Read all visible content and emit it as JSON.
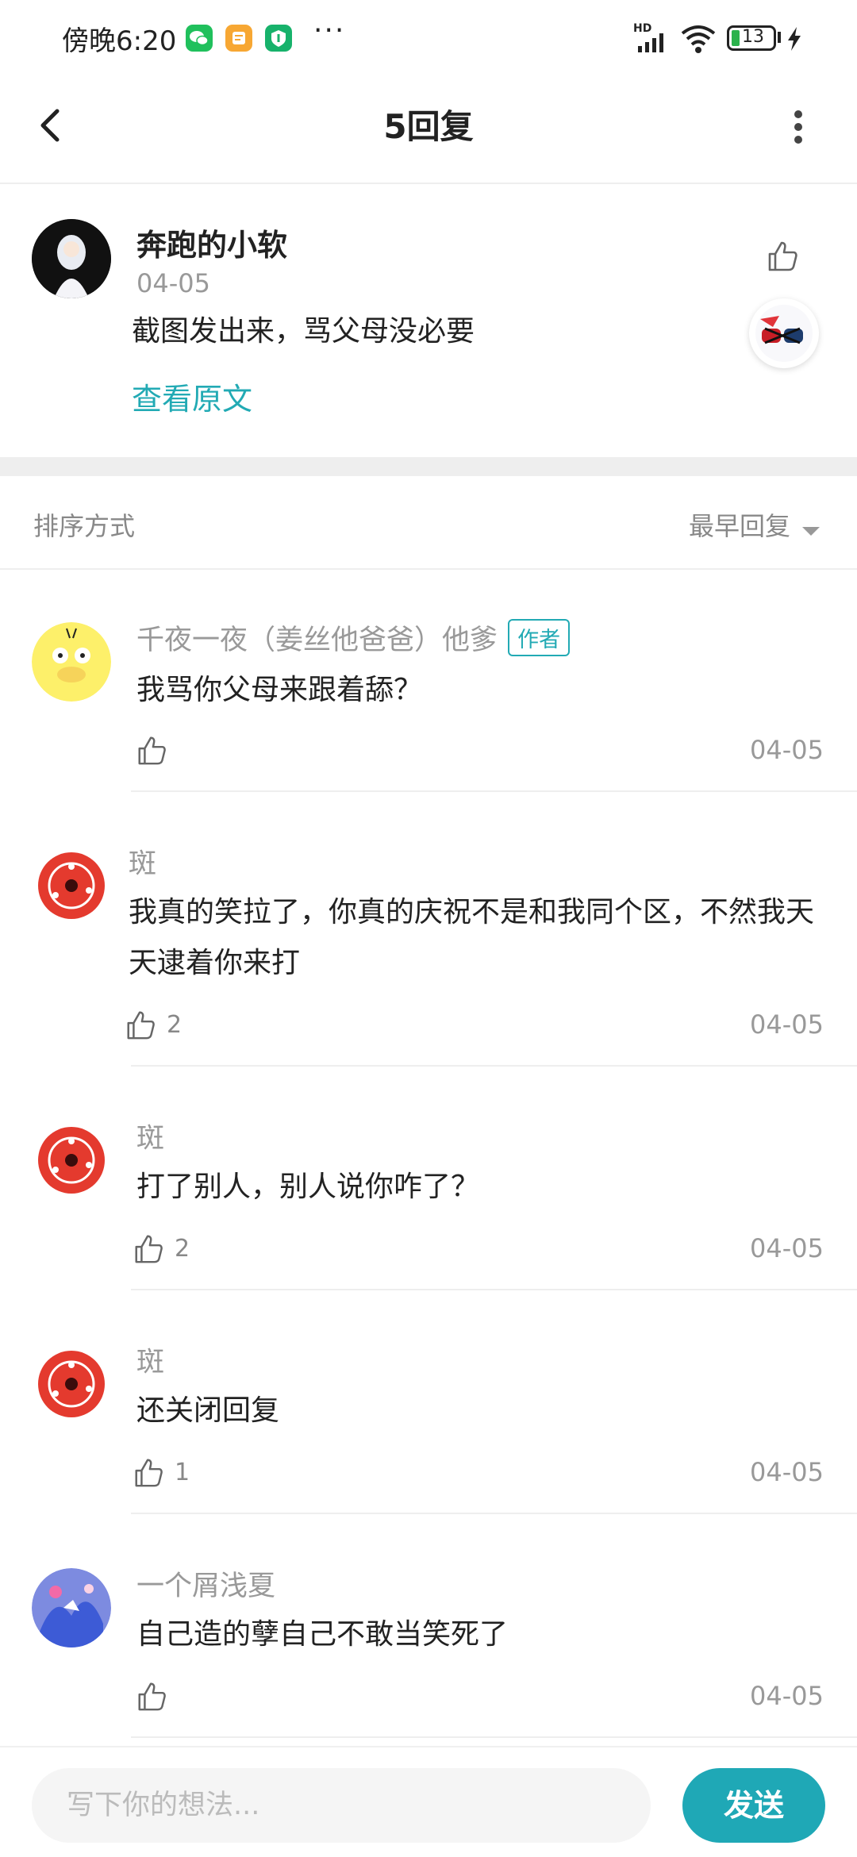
{
  "status_bar": {
    "time": "傍晚6:20",
    "more": "···",
    "network": "HD",
    "battery": "13"
  },
  "header": {
    "title": "5回复"
  },
  "original": {
    "author": "奔跑的小软",
    "date": "04-05",
    "text": "截图发出来，骂父母没必要",
    "view_original": "查看原文"
  },
  "sort": {
    "label": "排序方式",
    "value": "最早回复"
  },
  "replies": [
    {
      "name": "千夜一夜（姜丝他爸爸）他爹",
      "badge": "作者",
      "text": "我骂你父母来跟着舔？",
      "likes": "",
      "date": "04-05"
    },
    {
      "name": "斑",
      "badge": "",
      "text": "我真的笑拉了，你真的庆祝不是和我同个区，不然我天天逮着你来打",
      "likes": "2",
      "date": "04-05"
    },
    {
      "name": "斑",
      "badge": "",
      "text": "打了别人，别人说你咋了？",
      "likes": "2",
      "date": "04-05"
    },
    {
      "name": "斑",
      "badge": "",
      "text": "还关闭回复",
      "likes": "1",
      "date": "04-05"
    },
    {
      "name": "一个屑浅夏",
      "badge": "",
      "text": "自己造的孽自己不敢当笑死了",
      "likes": "",
      "date": "04-05"
    }
  ],
  "composer": {
    "placeholder": "写下你的想法...",
    "send_label": "发送"
  },
  "colors": {
    "accent": "#22aab4",
    "send_button": "#1fa8b6"
  }
}
